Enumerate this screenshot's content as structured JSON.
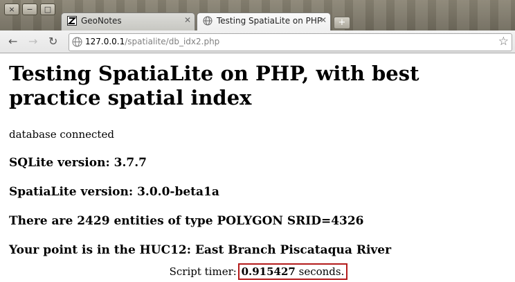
{
  "window": {
    "controls": [
      "×",
      "−",
      "□"
    ]
  },
  "tabs": [
    {
      "title": "GeoNotes",
      "favicon": "z-favicon-icon",
      "active": false
    },
    {
      "title": "Testing SpatiaLite on PHP",
      "favicon": "globe-favicon-icon",
      "active": true
    }
  ],
  "new_tab_symbol": "+",
  "toolbar": {
    "back_icon": "←",
    "forward_icon": "→",
    "reload_icon": "↻",
    "url_host": "127.0.0.1",
    "url_path": "/spatialite/db_idx2.php",
    "bookmark_icon": "☆"
  },
  "page": {
    "heading": "Testing SpatiaLite on PHP, with best practice spatial index",
    "status": "database connected",
    "lines": [
      "SQLite version: 3.7.7",
      "SpatiaLite version: 3.0.0-beta1a",
      "There are 2429 entities of type POLYGON SRID=4326",
      "Your point is in the HUC12: East Branch Piscataqua River"
    ],
    "timer_prefix": "Script timer: ",
    "timer_value": "0.915427",
    "timer_suffix": " seconds."
  },
  "colors": {
    "highlight_box": "#b31b1b"
  }
}
